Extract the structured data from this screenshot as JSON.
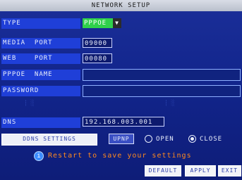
{
  "title": "NETWORK SETUP",
  "rows": {
    "type_label": "TYPE",
    "type_value": "PPPOE",
    "media_port_label": "MEDIA  PORT",
    "media_port_value": "09000",
    "web_port_label": "WEB    PORT",
    "web_port_value": "00080",
    "pppoe_name_label": "PPPOE  NAME",
    "pppoe_name_value": "",
    "password_label": "PASSWORD",
    "password_value": "",
    "dns_label": "DNS",
    "dns_value": "192.168.003.001"
  },
  "ddns_settings_label": "DDNS SETTINGS",
  "upnp_label": "UPNP",
  "upnp_options": {
    "open": "OPEN",
    "close": "CLOSE",
    "selected": "CLOSE"
  },
  "tip_text": "Restart to save your settings",
  "buttons": {
    "default": "DEFAULT",
    "apply": "APPLY",
    "exit": "EXIT"
  },
  "icons": {
    "dropdown": "dropdown-arrow-icon",
    "tip": "info-icon"
  }
}
